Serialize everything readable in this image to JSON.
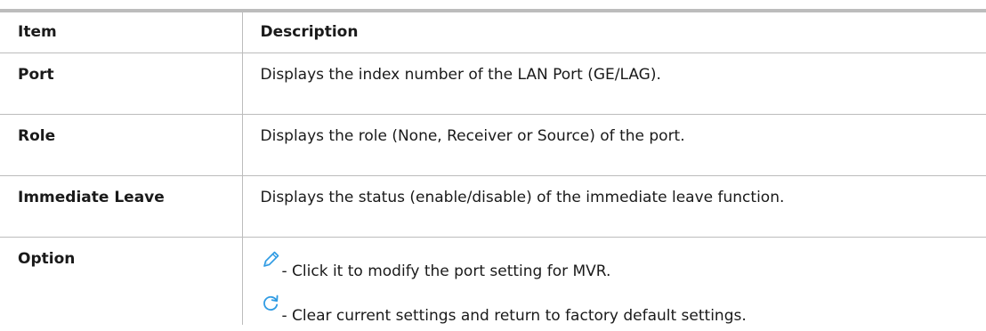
{
  "table": {
    "headers": {
      "item": "Item",
      "description": "Description"
    },
    "rows": [
      {
        "item": "Port",
        "description": "Displays the index number of the LAN Port (GE/LAG)."
      },
      {
        "item": "Role",
        "description": "Displays the role (None, Receiver or Source) of the port."
      },
      {
        "item": "Immediate Leave",
        "description": "Displays the status (enable/disable) of the immediate leave function."
      },
      {
        "item": "Option",
        "options": [
          {
            "icon": "edit-pencil-icon",
            "text": "- Click it to modify the port setting for MVR."
          },
          {
            "icon": "refresh-icon",
            "text": "- Clear current settings and return to factory default settings."
          }
        ]
      }
    ]
  },
  "colors": {
    "icon_blue": "#2f9be3",
    "border": "#bcbcbc"
  }
}
